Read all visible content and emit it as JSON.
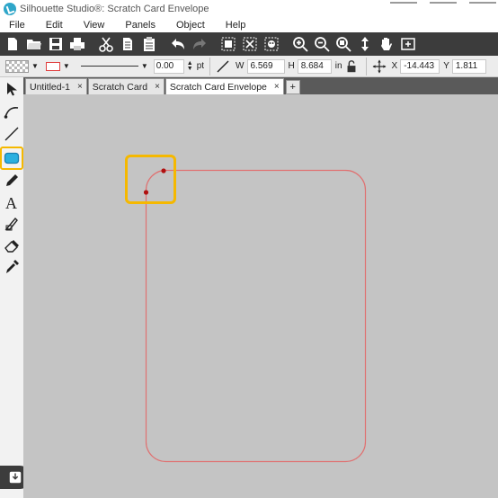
{
  "window": {
    "title": "Silhouette Studio®: Scratch Card Envelope"
  },
  "menu": [
    "File",
    "Edit",
    "View",
    "Panels",
    "Object",
    "Help"
  ],
  "toolbar": {
    "buttons": [
      "new-icon",
      "open-icon",
      "save-icon",
      "print-icon",
      "cut-icon",
      "copy-icon",
      "paste-icon",
      "undo-icon",
      "redo-icon",
      "group-icon",
      "ungroup-icon",
      "fill-icon",
      "zoom-in-icon",
      "zoom-out-icon",
      "zoom-fit-icon",
      "move-icon",
      "pan-icon",
      "page-fit-icon"
    ]
  },
  "properties": {
    "line_weight": "0.00",
    "line_unit": "pt",
    "width_label": "W",
    "width_value": "6.569",
    "height_label": "H",
    "height_value": "8.684",
    "size_unit": "in",
    "x_label": "X",
    "x_value": "-14.443",
    "y_label": "Y",
    "y_value": "1.811"
  },
  "tabs": [
    {
      "label": "Untitled-1",
      "close": "×",
      "active": false
    },
    {
      "label": "Scratch Card",
      "close": "×",
      "active": false
    },
    {
      "label": "Scratch Card Envelope",
      "close": "×",
      "active": true
    }
  ],
  "tab_add_label": "+",
  "colors": {
    "toolbar_bg": "#3c3c3c",
    "canvas_bg": "#c4c4c4",
    "shape_stroke": "#e07070",
    "point_fill": "#b01010",
    "highlight": "#f5b800",
    "selected_tool": "#2ab0e0"
  },
  "left_tools": [
    "select-icon",
    "point-edit-icon",
    "line-icon",
    "rounded-rectangle-icon",
    "pencil-icon",
    "text-icon",
    "knife-icon",
    "eraser-icon",
    "eyedropper-icon"
  ],
  "selected_tool": "rounded-rectangle-icon"
}
